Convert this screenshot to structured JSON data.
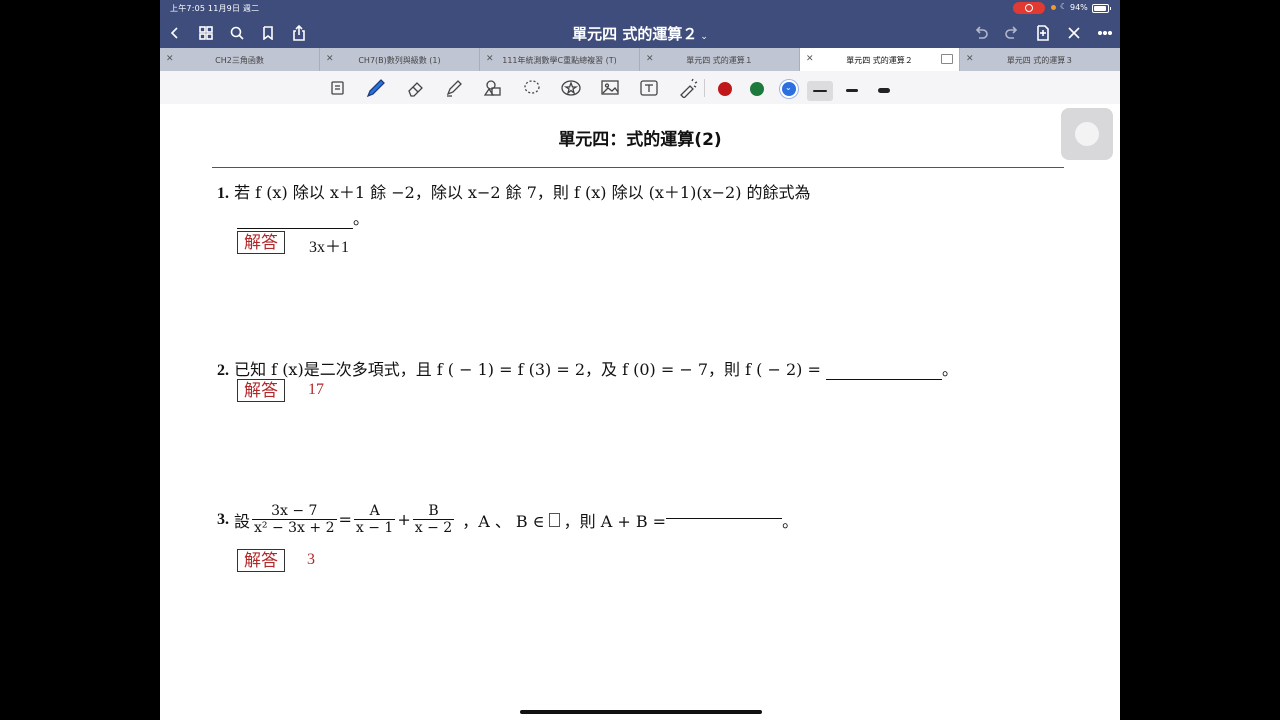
{
  "status_bar": {
    "time_date": "上午7:05   11月9日 週二",
    "battery": "94%"
  },
  "nav": {
    "title": "單元四 式的運算２"
  },
  "tabs": [
    {
      "label": "CH2三角函數",
      "active": false
    },
    {
      "label": "CH7(B)數列與級數 (1)",
      "active": false
    },
    {
      "label": "111年統測數學C重點總複習 (T)",
      "active": false
    },
    {
      "label": "單元四 式的運算１",
      "active": false
    },
    {
      "label": "單元四 式的運算２",
      "active": true
    },
    {
      "label": "單元四 式的運算３",
      "active": false
    }
  ],
  "toolbar": {
    "colors": [
      "#c0171b",
      "#1e7a3c",
      "#2e6fe0"
    ]
  },
  "document": {
    "heading": "單元四：式的運算(2)",
    "q1": {
      "num": "1.",
      "text": "若 f (x) 除以 x＋1 餘 −2，除以 x−2 餘 7，則 f (x) 除以 (x＋1)(x−2) 的餘式為",
      "tail": "。",
      "answer_label": "解答",
      "answer": "3x＋1"
    },
    "q2": {
      "num": "2.",
      "text": "已知 f (x)是二次多項式，且 f ( − 1) = f (3) = 2，及 f (0) = − 7，則 f ( − 2) =",
      "tail": "。",
      "answer_label": "解答",
      "answer": "17"
    },
    "q3": {
      "num": "3.",
      "lead": "設",
      "frac1_n": "3x − 7",
      "frac1_d": "x² − 3x + 2",
      "eq": "=",
      "frac2_n": "A",
      "frac2_d": "x − 1",
      "plus": "+",
      "frac3_n": "B",
      "frac3_d": "x − 2",
      "cond": "，A 、 B ∈",
      "then": "，則 A + B =",
      "tail": "。",
      "answer_label": "解答",
      "answer": "3"
    }
  }
}
